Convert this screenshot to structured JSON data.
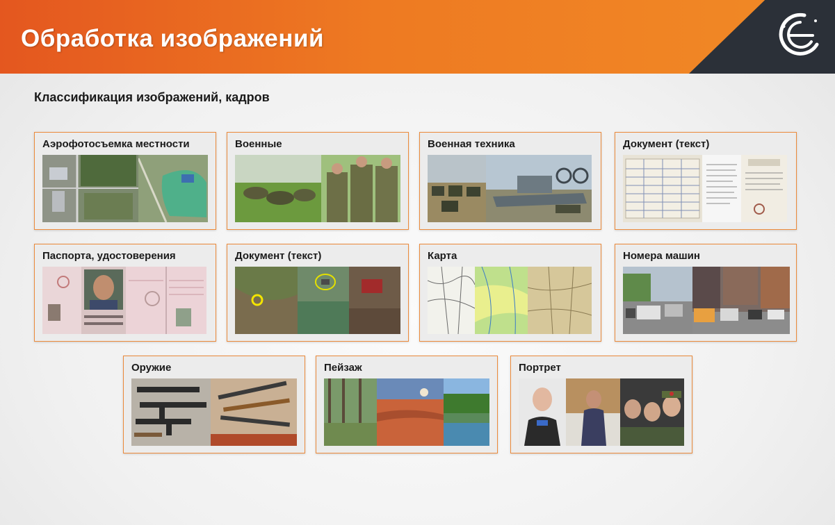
{
  "header": {
    "title": "Обработка изображений"
  },
  "subtitle": "Классификация изображений, кадров",
  "cards": [
    {
      "label": "Аэрофотосъемка местности"
    },
    {
      "label": "Военные"
    },
    {
      "label": "Военная техника"
    },
    {
      "label": "Документ (текст)"
    },
    {
      "label": "Паспорта, удостоверения"
    },
    {
      "label": "Документ (текст)"
    },
    {
      "label": "Карта"
    },
    {
      "label": "Номера машин"
    },
    {
      "label": "Оружие"
    },
    {
      "label": "Пейзаж"
    },
    {
      "label": "Портрет"
    }
  ],
  "colors": {
    "header_orange": "#ee7a22",
    "header_dark": "#2b3038",
    "card_border": "#ec8a3a",
    "card_bg": "#ececec"
  },
  "icons": {
    "logo": "company-logo-icon"
  }
}
